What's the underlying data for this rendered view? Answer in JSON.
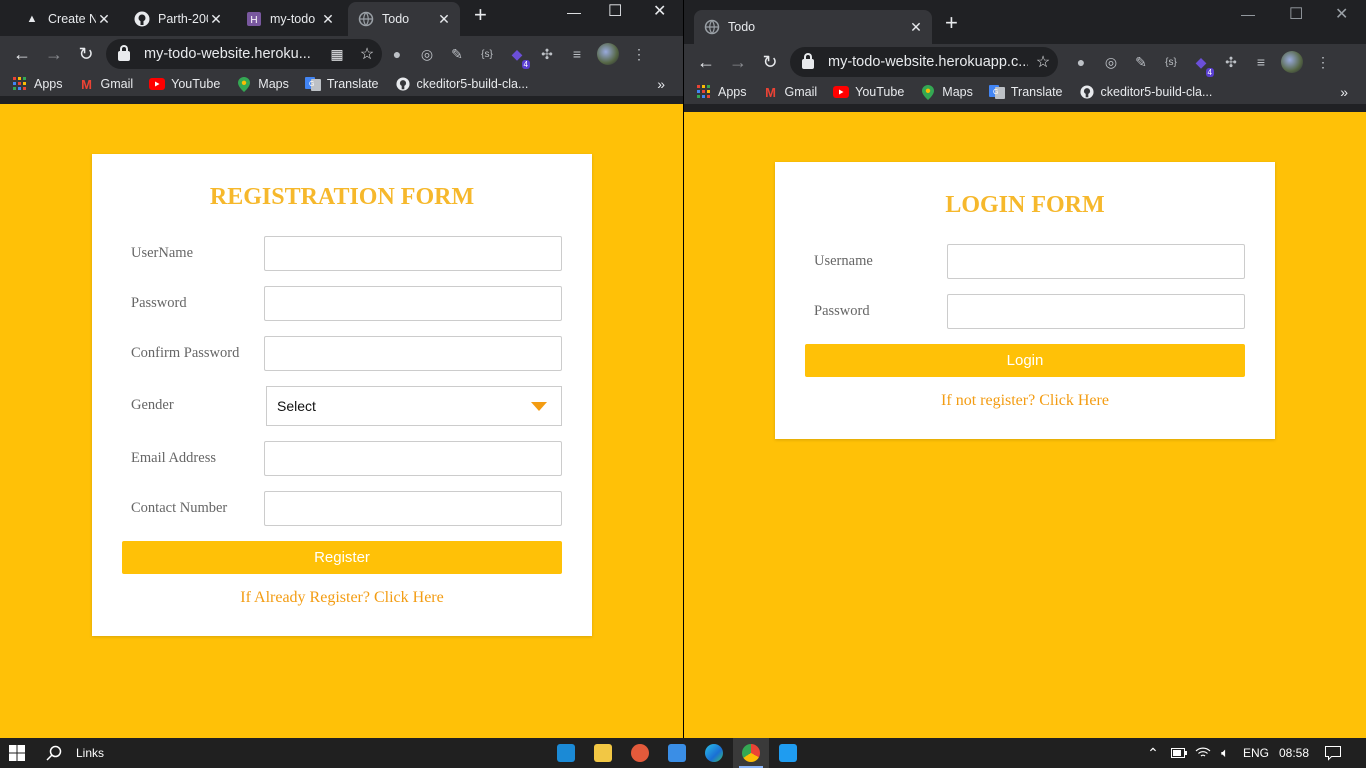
{
  "left_browser": {
    "tabs": [
      {
        "label": "Create N",
        "active": false
      },
      {
        "label": "Parth-200",
        "active": false
      },
      {
        "label": "my-todo",
        "active": false
      },
      {
        "label": "Todo",
        "active": true
      }
    ],
    "url": "my-todo-website.heroku...",
    "bookmarks": [
      "Apps",
      "Gmail",
      "YouTube",
      "Maps",
      "Translate",
      "ckeditor5-build-cla..."
    ],
    "extension_badge": "4"
  },
  "right_browser": {
    "tabs": [
      {
        "label": "Todo",
        "active": true
      }
    ],
    "url": "my-todo-website.herokuapp.c...",
    "bookmarks": [
      "Apps",
      "Gmail",
      "YouTube",
      "Maps",
      "Translate",
      "ckeditor5-build-cla..."
    ],
    "extension_badge": "4"
  },
  "registration_form": {
    "title": "REGISTRATION FORM",
    "fields": [
      {
        "label": "UserName",
        "value": ""
      },
      {
        "label": "Password",
        "value": ""
      },
      {
        "label": "Confirm Password",
        "value": ""
      },
      {
        "label": "Gender",
        "selected": "Select"
      },
      {
        "label": "Email Address",
        "value": ""
      },
      {
        "label": "Contact Number",
        "value": ""
      }
    ],
    "submit_label": "Register",
    "link_text": "If Already Register? Click Here"
  },
  "login_form": {
    "title": "LOGIN FORM",
    "fields": [
      {
        "label": "Username",
        "value": ""
      },
      {
        "label": "Password",
        "value": ""
      }
    ],
    "submit_label": "Login",
    "link_text": "If not register? Click Here"
  },
  "taskbar": {
    "search_label": "Links",
    "language": "ENG",
    "time": "08:58"
  },
  "colors": {
    "page_background": "#ffc107",
    "form_title": "#f6b82c",
    "link": "#f39c12",
    "browser_dark": "#202124",
    "browser_toolbar": "#35363a"
  }
}
